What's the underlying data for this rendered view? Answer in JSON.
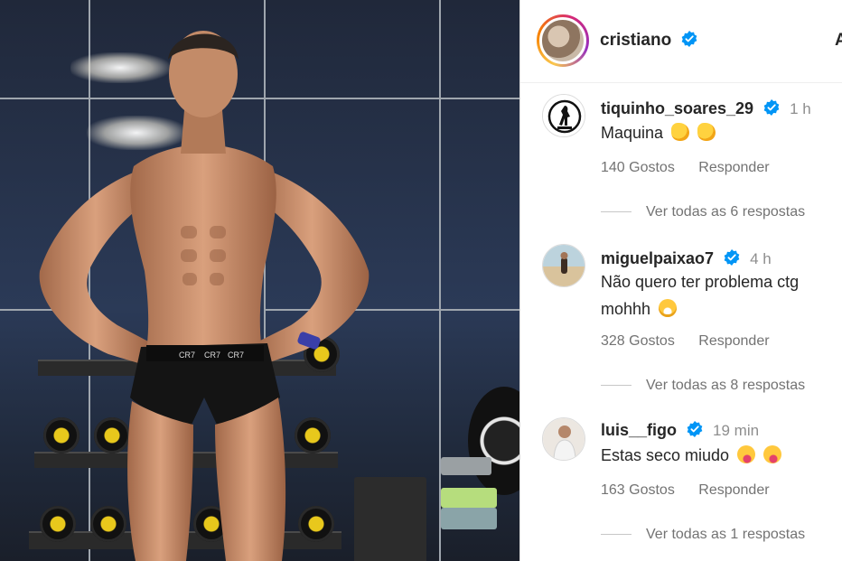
{
  "post": {
    "author": "cristiano",
    "author_verified": true,
    "header_action": "A"
  },
  "colors": {
    "verified": "#0095f6",
    "text_primary": "#262626",
    "text_secondary": "#737373"
  },
  "comments": [
    {
      "username": "tiquinho_soares_29",
      "verified": true,
      "time": "1 h",
      "text": "Maquina",
      "emoji": [
        "clapping-hands",
        "clapping-hands"
      ],
      "likes": "140 Gostos",
      "reply_label": "Responder",
      "view_replies": "Ver todas as 6 respostas"
    },
    {
      "username": "miguelpaixao7",
      "verified": true,
      "time": "4 h",
      "text_line1": "Não quero ter problema ctg",
      "text_line2": "mohhh",
      "emoji": [
        "grinning-sweat-face"
      ],
      "likes": "328 Gostos",
      "reply_label": "Responder",
      "view_replies": "Ver todas as 8 respostas"
    },
    {
      "username": "luis__figo",
      "verified": true,
      "time": "19 min",
      "text": "Estas seco miudo",
      "emoji": [
        "zany-face",
        "zany-face"
      ],
      "likes": "163 Gostos",
      "reply_label": "Responder",
      "view_replies": "Ver todas as 1 respostas"
    }
  ]
}
